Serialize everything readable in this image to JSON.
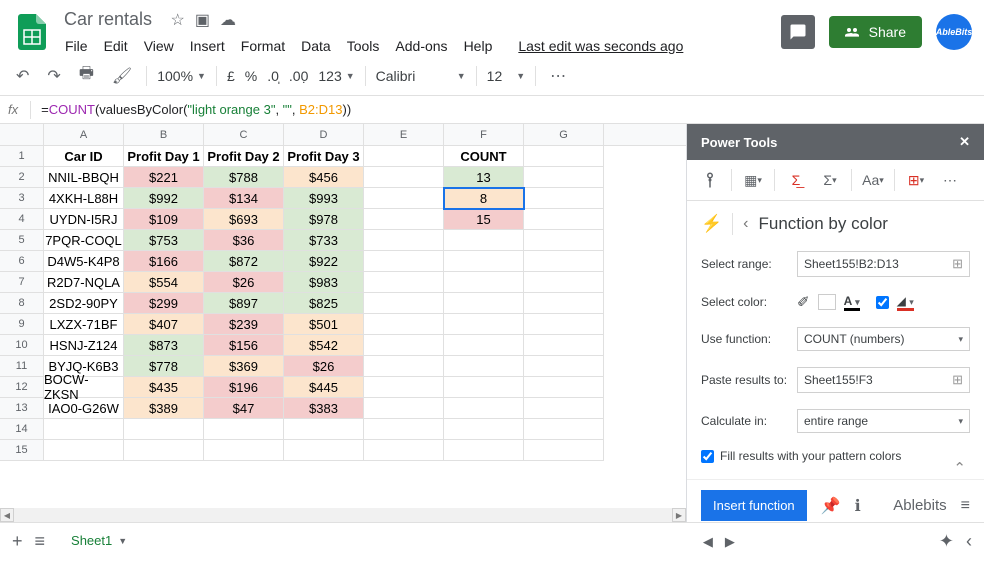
{
  "title": "Car rentals",
  "menu": [
    "File",
    "Edit",
    "View",
    "Insert",
    "Format",
    "Data",
    "Tools",
    "Add-ons",
    "Help"
  ],
  "last_edit": "Last edit was seconds ago",
  "share": "Share",
  "ablebits": "AbleBits",
  "toolbar": {
    "zoom": "100%",
    "currency": "£",
    "percent": "%",
    "format_num": "123",
    "font": "Calibri",
    "font_size": "12"
  },
  "formula": {
    "prefix": "=",
    "fn": "COUNT",
    "open": "(valuesByColor(",
    "str1": "\"light orange 3\"",
    "comma1": ", ",
    "str2": "\"\"",
    "comma2": ", ",
    "ref": "B2:D13",
    "close": "))"
  },
  "columns": [
    "A",
    "B",
    "C",
    "D",
    "E",
    "F",
    "G"
  ],
  "headers": [
    "Car ID",
    "Profit Day 1",
    "Profit Day 2",
    "Profit Day 3",
    "",
    "COUNT",
    ""
  ],
  "rows": [
    {
      "n": 2,
      "a": "NNIL-BBQH",
      "b": "$221",
      "bc": "red",
      "c": "$788",
      "cc": "green",
      "d": "$456",
      "dc": "orange",
      "f": "13",
      "fc": "green"
    },
    {
      "n": 3,
      "a": "4XKH-L88H",
      "b": "$992",
      "bc": "green",
      "c": "$134",
      "cc": "red",
      "d": "$993",
      "dc": "green",
      "f": "8",
      "fc": "orange",
      "sel": true
    },
    {
      "n": 4,
      "a": "UYDN-I5RJ",
      "b": "$109",
      "bc": "red",
      "c": "$693",
      "cc": "orange",
      "d": "$978",
      "dc": "green",
      "f": "15",
      "fc": "red"
    },
    {
      "n": 5,
      "a": "7PQR-COQL",
      "b": "$753",
      "bc": "green",
      "c": "$36",
      "cc": "red",
      "d": "$733",
      "dc": "green"
    },
    {
      "n": 6,
      "a": "D4W5-K4P8",
      "b": "$166",
      "bc": "red",
      "c": "$872",
      "cc": "green",
      "d": "$922",
      "dc": "green"
    },
    {
      "n": 7,
      "a": "R2D7-NQLA",
      "b": "$554",
      "bc": "orange",
      "c": "$26",
      "cc": "red",
      "d": "$983",
      "dc": "green"
    },
    {
      "n": 8,
      "a": "2SD2-90PY",
      "b": "$299",
      "bc": "red",
      "c": "$897",
      "cc": "green",
      "d": "$825",
      "dc": "green"
    },
    {
      "n": 9,
      "a": "LXZX-71BF",
      "b": "$407",
      "bc": "orange",
      "c": "$239",
      "cc": "red",
      "d": "$501",
      "dc": "orange"
    },
    {
      "n": 10,
      "a": "HSNJ-Z124",
      "b": "$873",
      "bc": "green",
      "c": "$156",
      "cc": "red",
      "d": "$542",
      "dc": "orange"
    },
    {
      "n": 11,
      "a": "BYJQ-K6B3",
      "b": "$778",
      "bc": "green",
      "c": "$369",
      "cc": "orange",
      "d": "$26",
      "dc": "red"
    },
    {
      "n": 12,
      "a": "BOCW-ZKSN",
      "b": "$435",
      "bc": "orange",
      "c": "$196",
      "cc": "red",
      "d": "$445",
      "dc": "orange"
    },
    {
      "n": 13,
      "a": "IAO0-G26W",
      "b": "$389",
      "bc": "orange",
      "c": "$47",
      "cc": "red",
      "d": "$383",
      "dc": "red"
    },
    {
      "n": 14
    },
    {
      "n": 15
    }
  ],
  "panel": {
    "title": "Power Tools",
    "subtitle": "Function by color",
    "labels": {
      "range": "Select range:",
      "color": "Select color:",
      "fn": "Use function:",
      "paste": "Paste results to:",
      "calc": "Calculate in:",
      "fill": "Fill results with your pattern colors"
    },
    "values": {
      "range": "Sheet155!B2:D13",
      "fn": "COUNT (numbers)",
      "paste": "Sheet155!F3",
      "calc": "entire range"
    },
    "insert": "Insert function",
    "brand": "Ablebits"
  },
  "sheet_tab": "Sheet1"
}
